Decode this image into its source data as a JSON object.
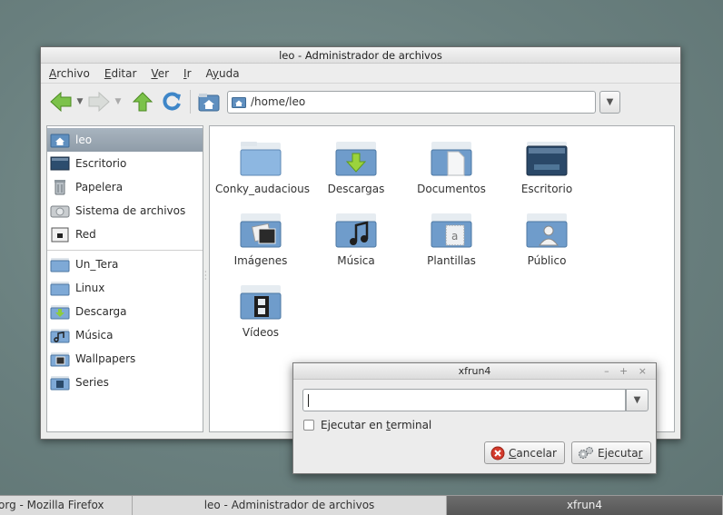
{
  "window": {
    "title": "leo - Administrador de archivos"
  },
  "menubar": [
    {
      "pre": "",
      "ul": "A",
      "post": "rchivo"
    },
    {
      "pre": "",
      "ul": "E",
      "post": "ditar"
    },
    {
      "pre": "",
      "ul": "V",
      "post": "er"
    },
    {
      "pre": "",
      "ul": "I",
      "post": "r"
    },
    {
      "pre": "A",
      "ul": "y",
      "post": "uda"
    }
  ],
  "toolbar": {
    "location": "/home/leo",
    "icons": [
      "back-icon",
      "forward-icon",
      "up-icon",
      "reload-icon",
      "home-icon"
    ]
  },
  "sidebar": {
    "places": [
      {
        "label": "leo",
        "icon": "home-folder-icon",
        "selected": true
      },
      {
        "label": "Escritorio",
        "icon": "desktop-icon"
      },
      {
        "label": "Papelera",
        "icon": "trash-icon"
      },
      {
        "label": "Sistema de archivos",
        "icon": "drive-icon"
      },
      {
        "label": "Red",
        "icon": "network-icon"
      }
    ],
    "bookmarks": [
      {
        "label": "Un_Tera",
        "icon": "folder-icon"
      },
      {
        "label": "Linux",
        "icon": "folder-icon"
      },
      {
        "label": "Descarga",
        "icon": "download-folder-icon"
      },
      {
        "label": "Música",
        "icon": "music-folder-icon"
      },
      {
        "label": "Wallpapers",
        "icon": "pictures-folder-icon"
      },
      {
        "label": "Series",
        "icon": "video-folder-icon"
      }
    ]
  },
  "files": [
    {
      "label": "Conky_audacious",
      "icon": "folder-icon"
    },
    {
      "label": "Descargas",
      "icon": "download-folder-icon"
    },
    {
      "label": "Documentos",
      "icon": "documents-folder-icon"
    },
    {
      "label": "Escritorio",
      "icon": "desktop-folder-icon"
    },
    {
      "label": "Imágenes",
      "icon": "pictures-folder-icon"
    },
    {
      "label": "Música",
      "icon": "music-folder-icon"
    },
    {
      "label": "Plantillas",
      "icon": "templates-folder-icon"
    },
    {
      "label": "Público",
      "icon": "public-folder-icon"
    },
    {
      "label": "Vídeos",
      "icon": "videos-folder-icon"
    }
  ],
  "run_dialog": {
    "title": "xfrun4",
    "window_controls": "– + ×",
    "input_value": "",
    "checkbox": {
      "pre": "Ejecutar en ",
      "ul": "t",
      "post": "erminal",
      "checked": false
    },
    "cancel": {
      "pre": "",
      "ul": "C",
      "post": "ancelar"
    },
    "execute": {
      "pre": "Ejecuta",
      "ul": "r",
      "post": ""
    }
  },
  "taskbar": [
    {
      "label": "org - Mozilla Firefox",
      "active": false
    },
    {
      "label": "leo - Administrador de archivos",
      "active": false
    },
    {
      "label": "xfrun4",
      "active": true
    }
  ],
  "colors": {
    "desktop": "#6f8584",
    "selection": "#95a2ad",
    "folder_blue": "#7ea9d6",
    "arrow_green": "#7cc24a",
    "cancel_red": "#d33a2c"
  }
}
